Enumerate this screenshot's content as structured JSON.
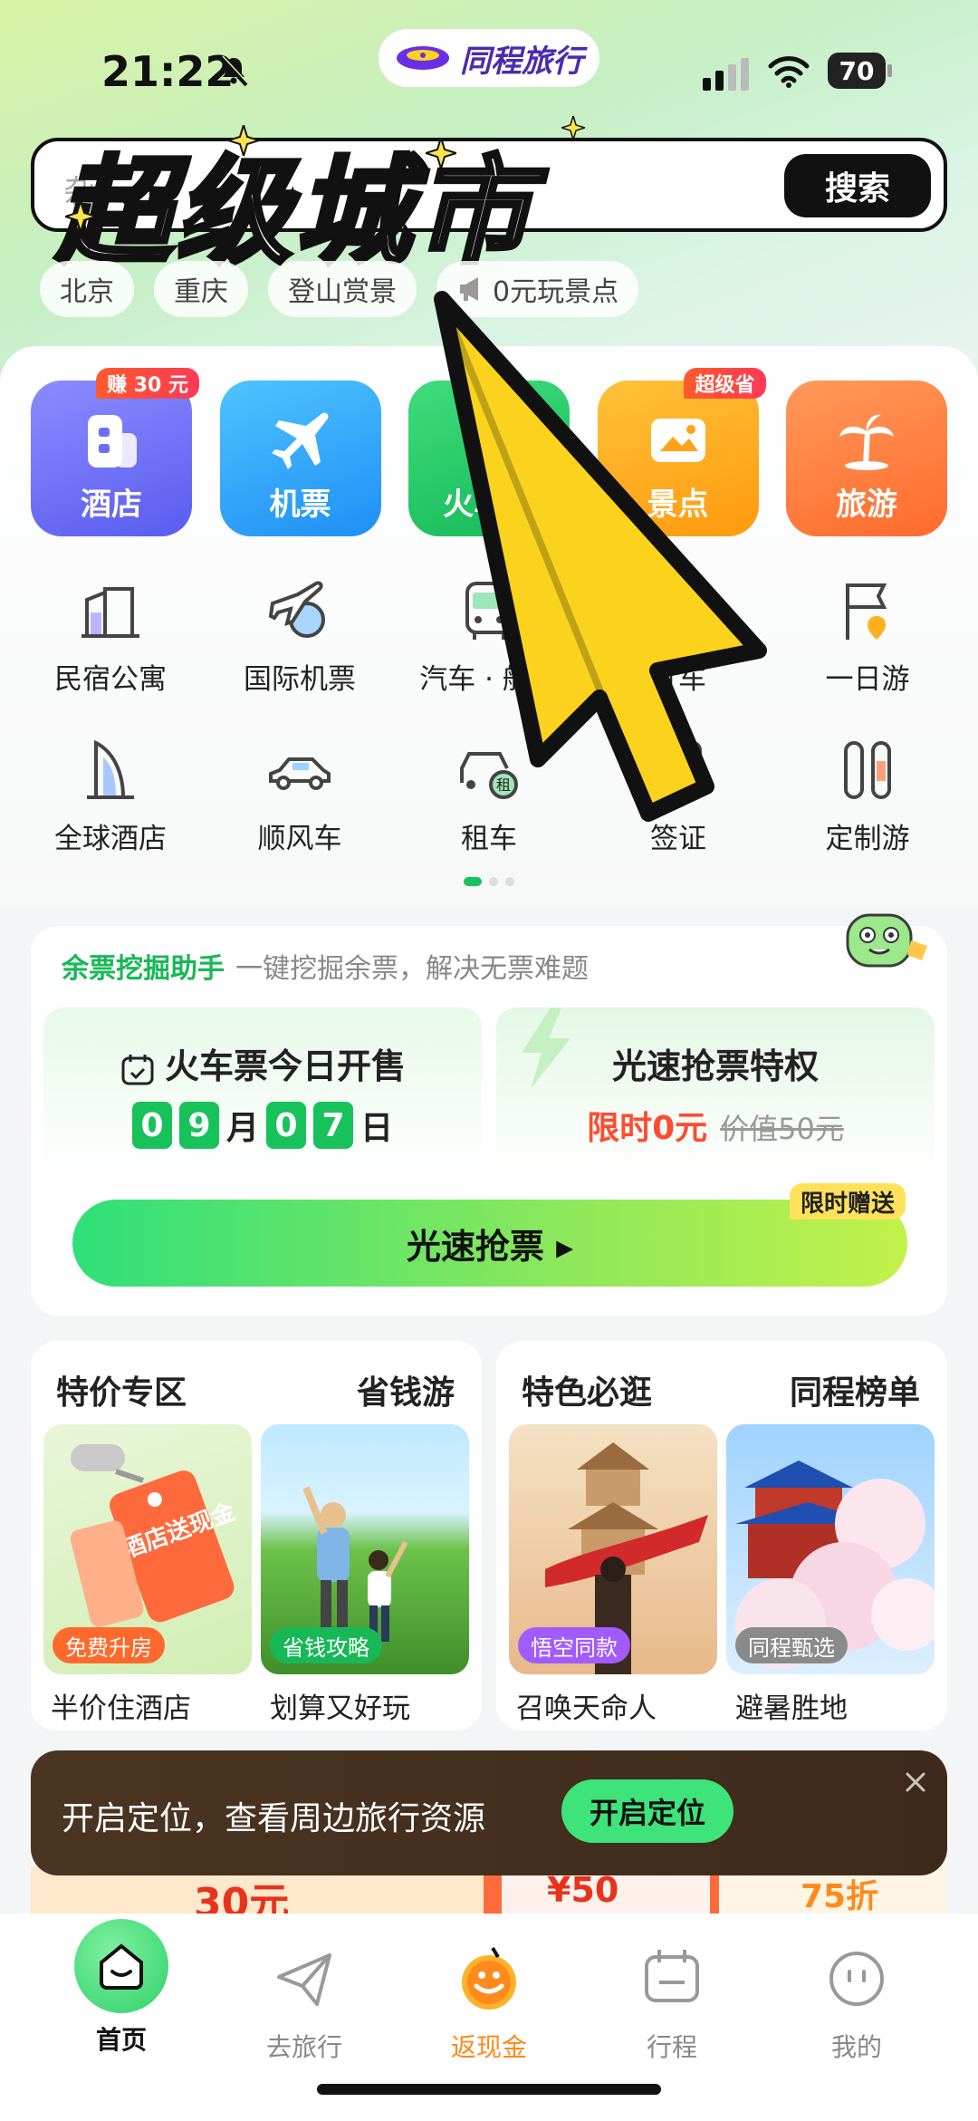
{
  "status_bar": {
    "time": "21:22",
    "battery": "70"
  },
  "brand": {
    "name": "同程旅行"
  },
  "search": {
    "placeholder": "杂…",
    "button": "搜索",
    "promo_overlay": "超级城市"
  },
  "chips": [
    "北京",
    "重庆",
    "登山赏景",
    "0元玩景点"
  ],
  "big_tiles": [
    {
      "label": "酒店",
      "badge": "赚 30 元",
      "color_from": "#7b7cff",
      "color_to": "#5a5cf0"
    },
    {
      "label": "机票",
      "badge": "",
      "color_from": "#3fb6ff",
      "color_to": "#1f8ff5"
    },
    {
      "label": "火车票",
      "badge": "",
      "color_from": "#2fd36e",
      "color_to": "#14b957"
    },
    {
      "label": "景点",
      "badge": "超级省",
      "color_from": "#ffb21f",
      "color_to": "#ff9a0d"
    },
    {
      "label": "旅游",
      "badge": "",
      "color_from": "#ff8a4a",
      "color_to": "#ff6b2c"
    }
  ],
  "grid_row1": [
    "民宿公寓",
    "国际机票",
    "汽车 · 船票",
    "打车",
    "一日游"
  ],
  "grid_row2": [
    "全球酒店",
    "顺风车",
    "租车",
    "签证",
    "定制游"
  ],
  "ticket": {
    "helper_title": "余票挖掘助手",
    "helper_sub": "一键挖掘余票，解决无票难题",
    "sale_title": "火车票今日开售",
    "month_digits": [
      "0",
      "9"
    ],
    "month_unit": "月",
    "day_digits": [
      "0",
      "7"
    ],
    "day_unit": "日",
    "speed_title": "光速抢票特权",
    "speed_price": "限时0元",
    "speed_old": "价值50元",
    "grab_button": "光速抢票 ▸",
    "limit_tag": "限时赠送"
  },
  "features_left": {
    "titles": [
      "特价专区",
      "省钱游"
    ],
    "items": [
      {
        "tag": "免费升房",
        "caption": "半价住酒店",
        "tag_color": "#ff6a2c",
        "sign_text": "住酒店送现金"
      },
      {
        "tag": "省钱攻略",
        "caption": "划算又好玩",
        "tag_color": "#18b857"
      }
    ]
  },
  "features_right": {
    "titles": [
      "特色必逛",
      "同程榜单"
    ],
    "items": [
      {
        "tag": "悟空同款",
        "caption": "召唤天命人",
        "tag_color": "#a15cff"
      },
      {
        "tag": "同程甄选",
        "caption": "避暑胜地",
        "tag_color": "#8a8a8a"
      }
    ]
  },
  "toast": {
    "text": "开启定位，查看周边旅行资源",
    "button": "开启定位"
  },
  "peek": {
    "a": "30元",
    "b": "¥50",
    "c": "75折"
  },
  "tabs": [
    {
      "label": "首页",
      "icon": "home-face-icon"
    },
    {
      "label": "去旅行",
      "icon": "paper-plane-icon"
    },
    {
      "label": "返现金",
      "icon": "cashback-coin-icon"
    },
    {
      "label": "行程",
      "icon": "calendar-icon"
    },
    {
      "label": "我的",
      "icon": "profile-face-icon"
    }
  ],
  "colors": {
    "brand_green": "#18c25a",
    "accent_orange": "#ff9a0d",
    "cashback_orange": "#ff8a1c"
  }
}
